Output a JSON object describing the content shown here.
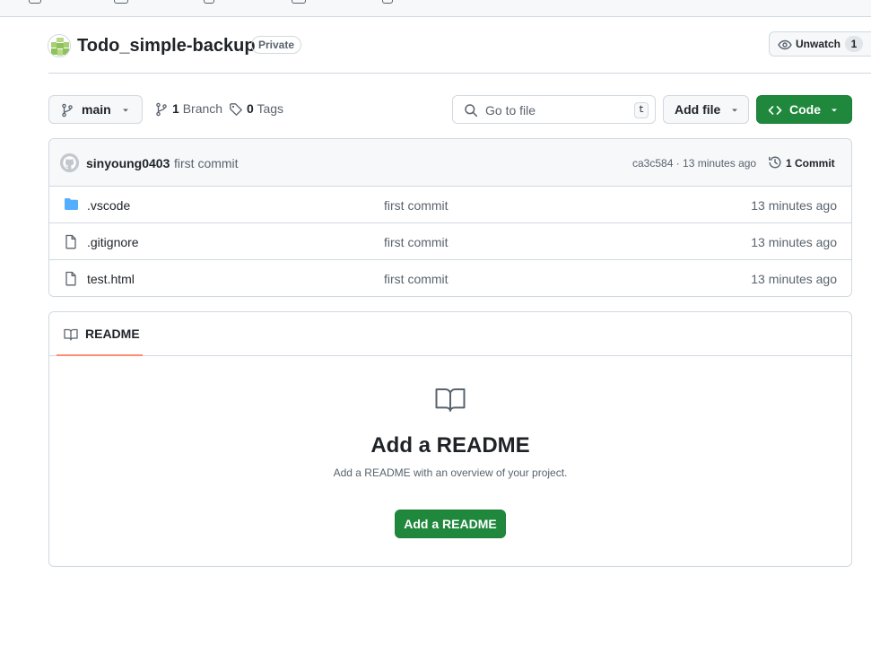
{
  "repo": {
    "name": "Todo_simple-backup",
    "visibility": "Private",
    "watch_label": "Unwatch",
    "watch_count": "1"
  },
  "toolbar": {
    "branch": "main",
    "branch_count": "1",
    "branch_label": "Branch",
    "tag_count": "0",
    "tag_label": "Tags",
    "search_placeholder": "Go to file",
    "search_shortcut": "t",
    "add_file_label": "Add file",
    "code_label": "Code"
  },
  "commit": {
    "author": "sinyoung0403",
    "message": "first commit",
    "hash_time": "ca3c584 · 13 minutes ago",
    "commits_label": "1 Commit"
  },
  "files": [
    {
      "name": ".vscode",
      "type": "folder",
      "message": "first commit",
      "age": "13 minutes ago"
    },
    {
      "name": ".gitignore",
      "type": "file",
      "message": "first commit",
      "age": "13 minutes ago"
    },
    {
      "name": "test.html",
      "type": "file",
      "message": "first commit",
      "age": "13 minutes ago"
    }
  ],
  "readme": {
    "tab_label": "README",
    "title": "Add a README",
    "subtitle": "Add a README with an overview of your project.",
    "button_label": "Add a README"
  },
  "colors": {
    "primary_button": "#1f883d",
    "folder_icon": "#54aeff",
    "tab_underline": "#fd8c73"
  }
}
